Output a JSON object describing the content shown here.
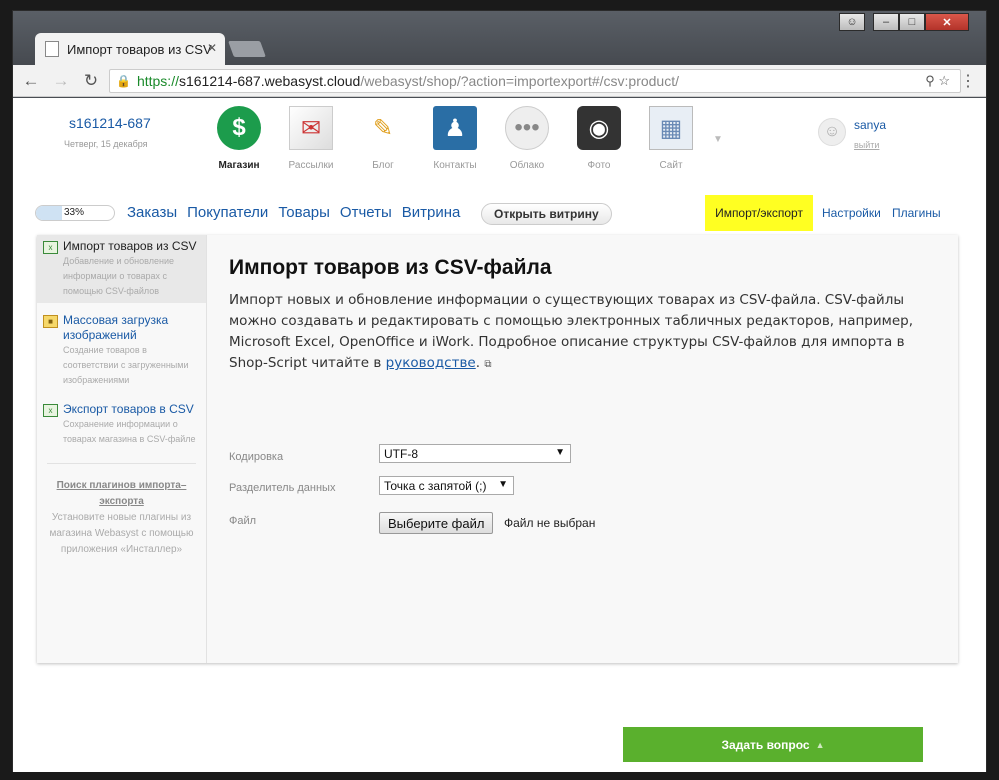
{
  "browser": {
    "tab_title": "Импорт товаров из CSV",
    "url_scheme": "https://",
    "url_host": "s161214-687.webasyst.cloud",
    "url_path": "/webasyst/shop/?action=importexport#/csv:product/"
  },
  "header": {
    "shop_name": "s161214-687",
    "date": "Четверг, 15 декабря",
    "apps": [
      {
        "label": "Магазин",
        "icon": "dollar-icon",
        "active": true
      },
      {
        "label": "Рассылки",
        "icon": "mailer-icon"
      },
      {
        "label": "Блог",
        "icon": "pencil-icon"
      },
      {
        "label": "Контакты",
        "icon": "contacts-icon"
      },
      {
        "label": "Облако",
        "icon": "cloud-icon"
      },
      {
        "label": "Фото",
        "icon": "camera-icon"
      },
      {
        "label": "Сайт",
        "icon": "site-icon"
      }
    ],
    "user": {
      "name": "sanya",
      "exit": "выйти"
    }
  },
  "nav": {
    "progress_label": "33%",
    "progress_fraction": 0.33,
    "items": [
      "Заказы",
      "Покупатели",
      "Товары",
      "Отчеты",
      "Витрина"
    ],
    "storefront_button": "Открыть витрину",
    "import_export": "Импорт/экспорт",
    "settings": "Настройки",
    "plugins": "Плагины"
  },
  "sidebar": {
    "items": [
      {
        "title": "Импорт товаров из CSV",
        "desc": "Добавление и обновление информации о товарах с помощью CSV-файлов"
      },
      {
        "title": "Массовая загрузка изображений",
        "desc": "Создание товаров в соответствии с загруженными изображениями"
      },
      {
        "title": "Экспорт товаров в CSV",
        "desc": "Сохранение информации о товарах магазина в CSV-файле"
      }
    ],
    "plugins_title": "Поиск плагинов импорта–экспорта",
    "plugins_text": "Установите новые плагины из магазина Webasyst с помощью приложения «Инсталлер»"
  },
  "main": {
    "title": "Импорт товаров из CSV-файла",
    "description": "Импорт новых и обновление информации о существующих товарах из CSV-файла. CSV-файлы можно создавать и редактировать с помощью электронных табличных редакторов, например, Microsoft Excel, OpenOffice и iWork. Подробное описание структуры CSV-файлов для импорта в Shop-Script читайте в ",
    "description_link": "руководстве",
    "description_end": ".",
    "encoding_label": "Кодировка",
    "encoding_value": "UTF-8",
    "separator_label": "Разделитель данных",
    "separator_value": "Точка с запятой (;)",
    "file_label": "Файл",
    "file_button": "Выберите файл",
    "file_status": "Файл не выбран"
  },
  "footer": {
    "ask_button": "Задать вопрос"
  }
}
